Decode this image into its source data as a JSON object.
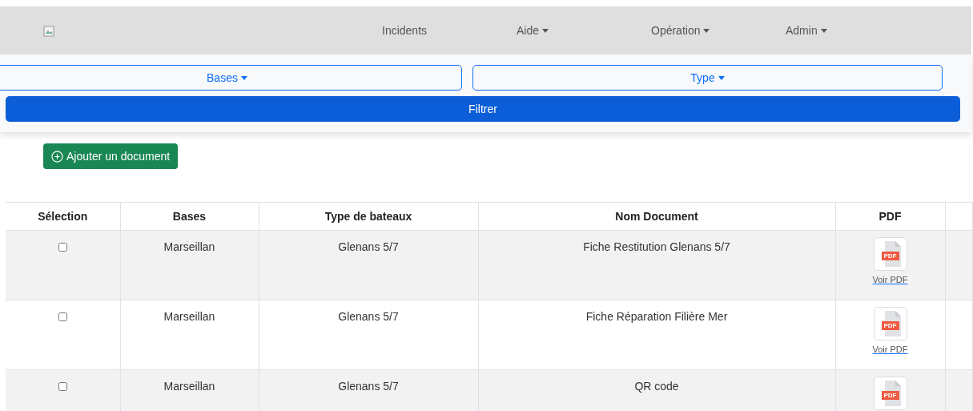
{
  "navbar": {
    "items": [
      {
        "label": "Incidents",
        "dropdown": false
      },
      {
        "label": "Aide",
        "dropdown": true
      },
      {
        "label": "Opération",
        "dropdown": true
      },
      {
        "label": "Admin",
        "dropdown": true
      }
    ]
  },
  "filters": {
    "dropdowns": [
      "Bases",
      "Type"
    ],
    "submit": "Filtrer"
  },
  "add_button": "Ajouter un document",
  "table": {
    "columns": [
      "Sélection",
      "Bases",
      "Type de bateaux",
      "Nom Document",
      "PDF"
    ],
    "rows": [
      {
        "checked": false,
        "base": "Marseillan",
        "boat_type": "Glenans 5/7",
        "document": "Fiche Restitution Glenans 5/7",
        "badge": "PDF",
        "link": "Voir PDF"
      },
      {
        "checked": false,
        "base": "Marseillan",
        "boat_type": "Glenans 5/7",
        "document": "Fiche Réparation Filière Mer",
        "badge": "PDF",
        "link": "Voir PDF"
      },
      {
        "checked": false,
        "base": "Marseillan",
        "boat_type": "Glenans 5/7",
        "document": "QR code",
        "badge": "PDF"
      }
    ]
  }
}
